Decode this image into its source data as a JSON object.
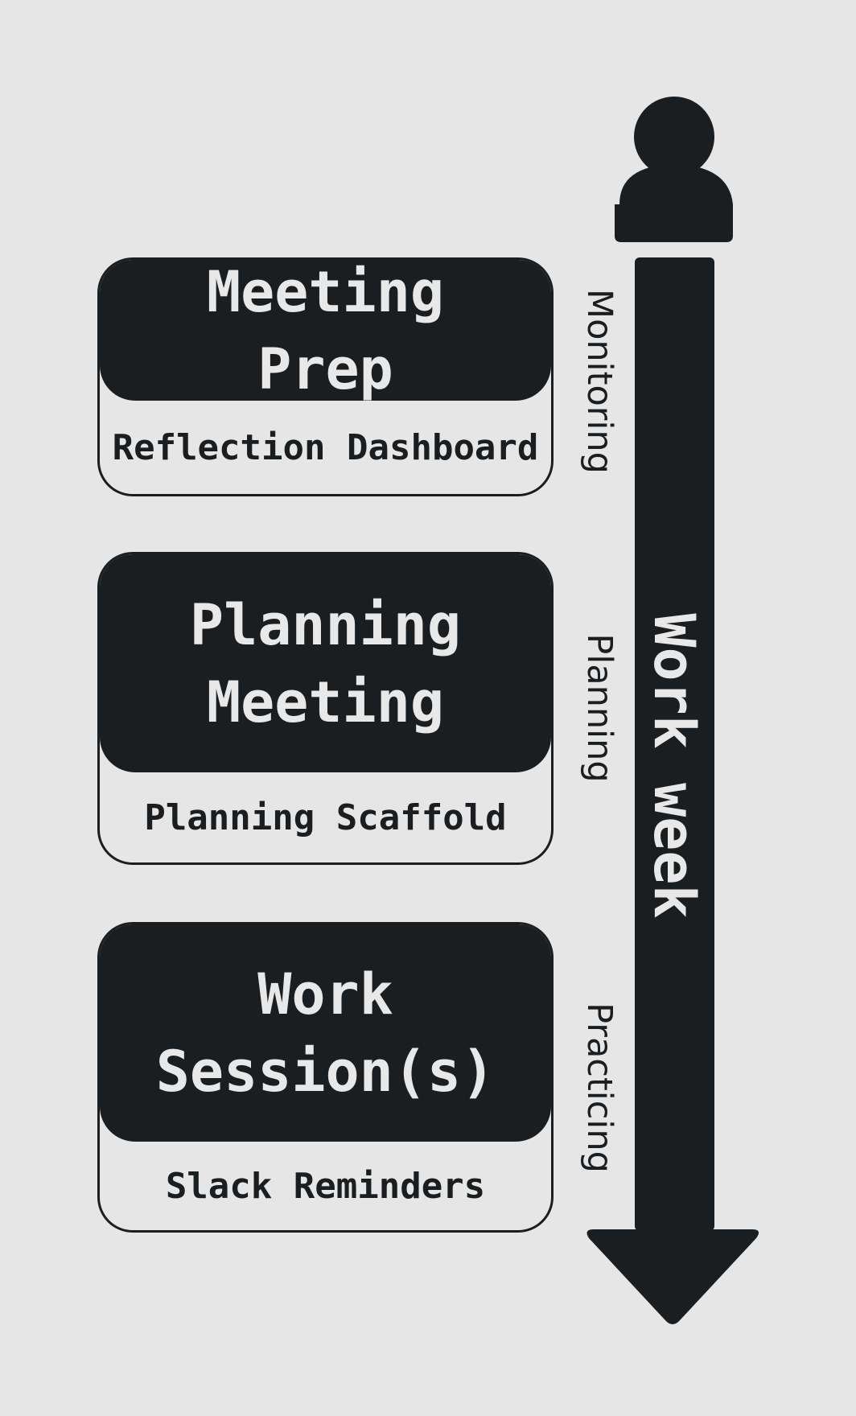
{
  "cards": [
    {
      "title": "Meeting Prep",
      "subtitle": "Reflection Dashboard",
      "stage": "Monitoring"
    },
    {
      "title": "Planning Meeting",
      "subtitle": "Planning Scaffold",
      "stage": "Planning"
    },
    {
      "title": "Work Session(s)",
      "subtitle": "Slack Reminders",
      "stage": "Practicing"
    }
  ],
  "axis": {
    "label": "Work week",
    "direction": "down"
  },
  "icons": {
    "top": "person-icon",
    "bottom": "arrow-down-icon"
  },
  "colors": {
    "background": "#e6e6e6",
    "dark": "#1a1e20",
    "light_text": "#e8e8e8"
  }
}
